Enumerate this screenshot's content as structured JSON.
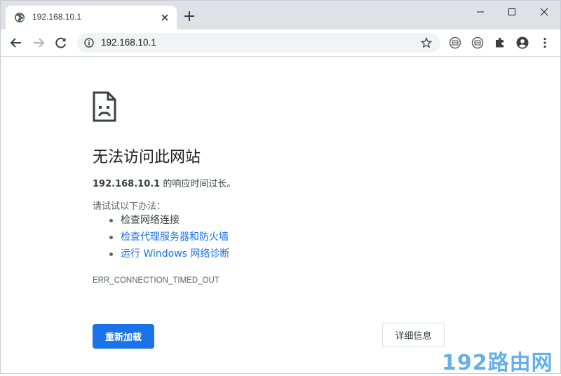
{
  "browser": {
    "tab": {
      "title": "192.168.10.1",
      "favicon": "globe-icon"
    },
    "address_bar": {
      "url": "192.168.10.1"
    },
    "window_controls": [
      "minimize-icon",
      "maximize-icon",
      "close-icon"
    ],
    "toolbar_icons": [
      "back-arrow-icon",
      "forward-arrow-icon",
      "reload-icon",
      "info-icon",
      "star-icon",
      "extension-icon",
      "extension-icon",
      "puzzle-icon",
      "account-icon",
      "more-icon"
    ]
  },
  "error_page": {
    "heading": "无法访问此网站",
    "summary": {
      "host": "192.168.10.1",
      "message": " 的响应时间过长。"
    },
    "try_label": "请试试以下办法：",
    "suggestions": [
      {
        "text": "检查网络连接",
        "is_link": false
      },
      {
        "text": "检查代理服务器和防火墙",
        "is_link": true
      },
      {
        "text": "运行 Windows 网络诊断",
        "is_link": true
      }
    ],
    "error_code": "ERR_CONNECTION_TIMED_OUT",
    "reload_label": "重新加载",
    "details_label": "详细信息"
  },
  "watermark": {
    "text": "192路由网"
  },
  "colors": {
    "accent": "#1a73e8",
    "tabstrip": "#dee1e6",
    "omnibox": "#f1f3f4",
    "watermark": "#4da3e3"
  }
}
